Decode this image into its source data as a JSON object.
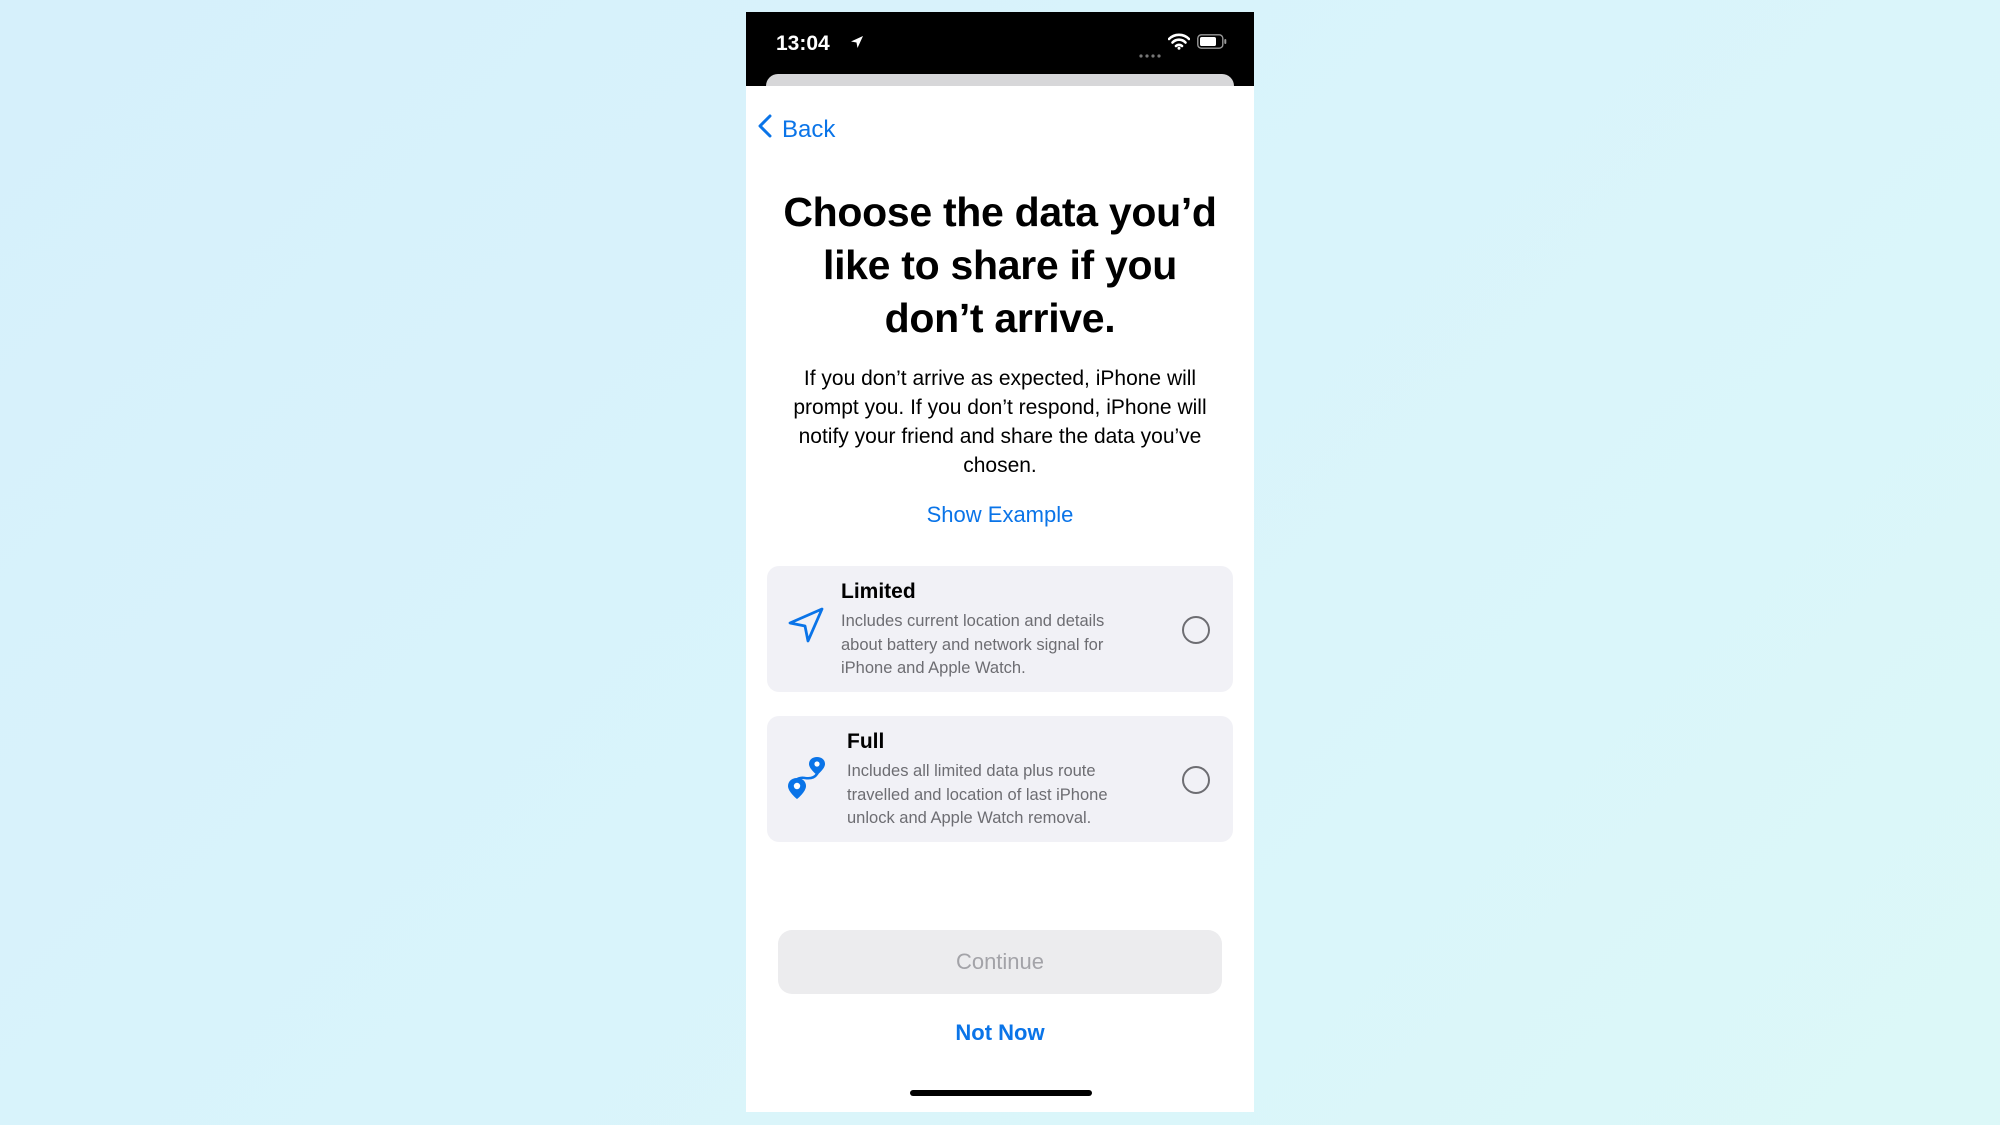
{
  "status_bar": {
    "time": "13:04",
    "icons": [
      "location-arrow-icon",
      "cellular-signal-icon",
      "wifi-icon",
      "battery-icon"
    ]
  },
  "nav": {
    "back_label": "Back"
  },
  "content": {
    "title": "Choose the data you’d like to share if you don’t arrive.",
    "description": "If you don’t arrive as expected, iPhone will prompt you. If you don’t respond, iPhone will notify your friend and share the data you’ve chosen.",
    "show_example_label": "Show Example"
  },
  "options": [
    {
      "title": "Limited",
      "description": "Includes current location and details about battery and network signal for iPhone and Apple Watch.",
      "icon": "location-arrow-icon",
      "selected": false
    },
    {
      "title": "Full",
      "description": "Includes all limited data plus route travelled and location of last iPhone unlock and Apple Watch removal.",
      "icon": "route-icon",
      "selected": false
    }
  ],
  "actions": {
    "continue_label": "Continue",
    "not_now_label": "Not Now"
  },
  "colors": {
    "accent": "#0a74e8",
    "background": "#d9f4fb",
    "option_background": "#f1f1f6",
    "disabled_text": "#a3a3a8"
  }
}
